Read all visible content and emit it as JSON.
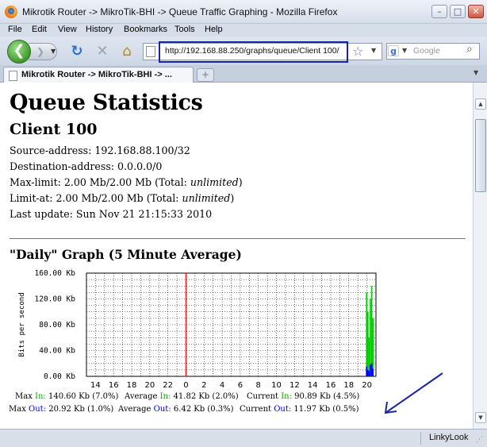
{
  "window": {
    "title": "Mikrotik Router -> MikroTik-BHI -> Queue Traffic Graphing - Mozilla Firefox",
    "minimize_glyph": "–",
    "maximize_glyph": "□",
    "close_glyph": "✕"
  },
  "menu": {
    "items": [
      "File",
      "Edit",
      "View",
      "History",
      "Bookmarks",
      "Tools",
      "Help"
    ]
  },
  "toolbar": {
    "url": "http://192.168.88.250/graphs/queue/Client 100/",
    "search_placeholder": "Google",
    "icons": {
      "back": "back-arrow-icon",
      "forward": "forward-arrow-icon",
      "reload": "reload-icon",
      "stop": "stop-icon",
      "home": "home-icon",
      "bookmark": "star-icon",
      "search_engine": "google-icon",
      "search": "magnifier-icon"
    },
    "url_highlight_color": "#1a24a8"
  },
  "tabs": [
    {
      "label": "Mikrotik Router -> MikroTik-BHI -> ..."
    }
  ],
  "page": {
    "title": "Queue Statistics",
    "client": "Client 100",
    "source_address": "Source-address: 192.168.88.100/32",
    "destination_address": "Destination-address: 0.0.0.0/0",
    "max_limit_prefix": "Max-limit: 2.00 Mb/2.00 Mb (Total: ",
    "limit_at_prefix": "Limit-at: 2.00 Mb/2.00 Mb (Total: ",
    "unlimited": "unlimited",
    "close_paren": ")",
    "last_update": "Last update: Sun Nov 21 21:15:33 2010",
    "graph_heading": "\"Daily\" Graph (5 Minute Average)"
  },
  "stats": {
    "in": {
      "max_label": "Max ",
      "max_value": " 140.60 Kb (7.0%)",
      "avg_label": "Average ",
      "avg_value": " 41.82 Kb (2.0%)",
      "cur_label": "Current ",
      "cur_value": " 90.89 Kb (4.5%)",
      "word": "In:"
    },
    "out": {
      "max_label": "Max ",
      "max_value": " 20.92 Kb (1.0%)",
      "avg_label": "Average ",
      "avg_value": " 6.42 Kb (0.3%)",
      "cur_label": "Current ",
      "cur_value": " 11.97 Kb (0.5%)",
      "word": "Out:"
    }
  },
  "chart_data": {
    "type": "area",
    "title": "",
    "ylabel": "Bits per second",
    "xlabel": "",
    "ylim": [
      0,
      160
    ],
    "y_unit": "Kb",
    "y_ticks": [
      "0.00 Kb",
      "40.00 Kb",
      "80.00 Kb",
      "120.00 Kb",
      "160.00 Kb"
    ],
    "y_tick_values": [
      0,
      40,
      80,
      120,
      160
    ],
    "x_ticks": [
      "14",
      "16",
      "18",
      "20",
      "22",
      "0",
      "2",
      "4",
      "6",
      "8",
      "10",
      "12",
      "14",
      "16",
      "18",
      "20"
    ],
    "grid": true,
    "series": [
      {
        "name": "In",
        "color": "#00cc00",
        "values": [
          0,
          0,
          130,
          100,
          60,
          120,
          140,
          90
        ]
      },
      {
        "name": "Out",
        "color": "#0000ff",
        "values": [
          0,
          0,
          15,
          10,
          8,
          18,
          20,
          12
        ]
      }
    ],
    "midnight_marker_color": "#ff0000"
  },
  "status": {
    "text": "LinkyLook"
  }
}
